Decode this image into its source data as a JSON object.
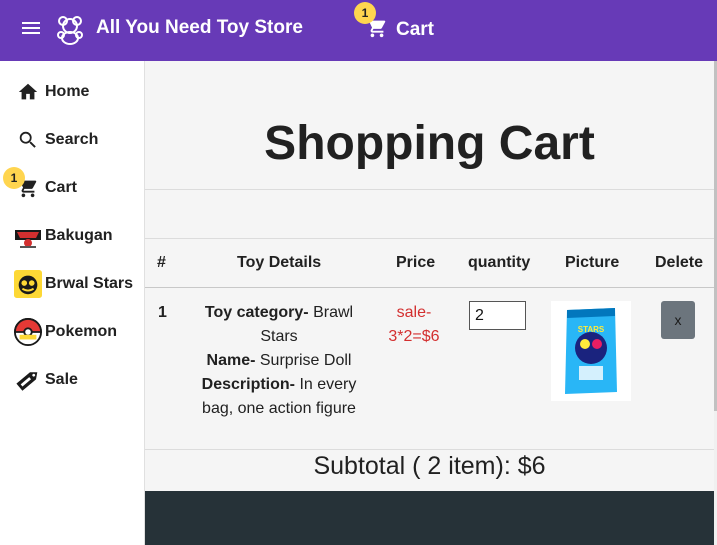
{
  "appbar": {
    "title": "All You Need Toy Store",
    "menu_icon": "menu-icon",
    "logo_icon": "teddy-bear-icon",
    "cart_label": "Cart",
    "cart_count": "1",
    "background_color": "#673ab7"
  },
  "sidebar": {
    "items": [
      {
        "label": "Home",
        "icon": "home-icon"
      },
      {
        "label": "Search",
        "icon": "search-icon"
      },
      {
        "label": "Cart",
        "icon": "cart-icon",
        "badge": "1"
      },
      {
        "label": "Bakugan",
        "icon": "bakugan-logo-icon"
      },
      {
        "label": "Brwal Stars",
        "icon": "brawl-stars-logo-icon"
      },
      {
        "label": "Pokemon",
        "icon": "pokeball-icon"
      },
      {
        "label": "Sale",
        "icon": "sale-tag-icon"
      }
    ]
  },
  "main": {
    "title": "Shopping Cart",
    "table": {
      "headers": [
        "#",
        "Toy Details",
        "Price",
        "quantity",
        "Picture",
        "Delete"
      ],
      "rows": [
        {
          "index": "1",
          "category_label": "Toy category-",
          "category_value": "Brawl Stars",
          "name_label": "Name-",
          "name_value": "Surprise Doll",
          "description_label": "Description-",
          "description_value": "In every bag, one action figure",
          "price": "sale-3*2=$6",
          "quantity": "2",
          "picture_alt": "Brawl Stars surprise bag",
          "delete_label": "x"
        }
      ]
    },
    "subtotal": "Subtotal ( 2 item): $6",
    "price_color": "#d32f2f",
    "footer_color": "#263238"
  }
}
